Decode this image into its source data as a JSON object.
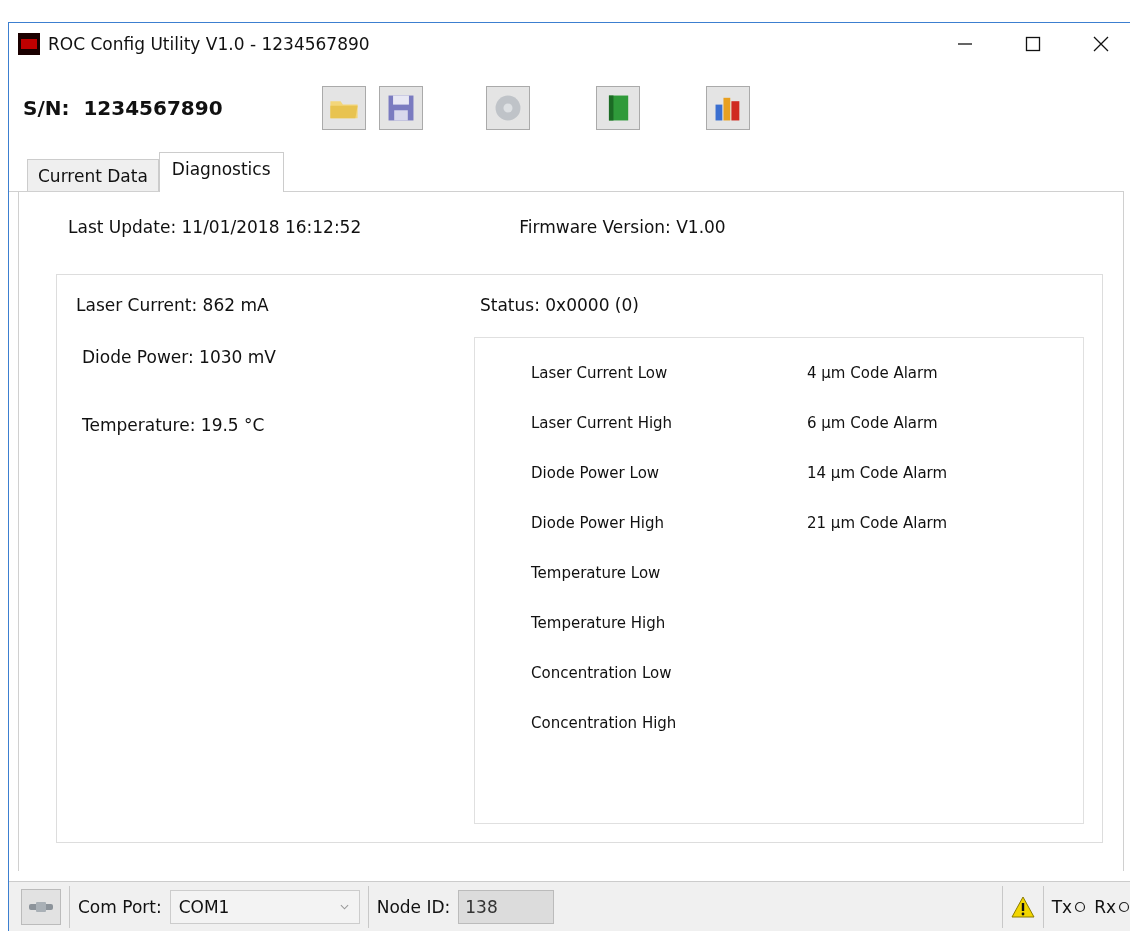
{
  "window": {
    "title": "ROC Config Utility V1.0 - 1234567890"
  },
  "serial": {
    "label": "S/N:",
    "value": "1234567890"
  },
  "toolbar": [
    {
      "kind": "open"
    },
    {
      "kind": "save"
    },
    {
      "kind": "disc"
    },
    {
      "kind": "book"
    },
    {
      "kind": "chart"
    }
  ],
  "tabs": [
    {
      "label": "Current Data",
      "selected": false
    },
    {
      "label": "Diagnostics",
      "selected": true
    }
  ],
  "last_update": {
    "label": "Last Update:",
    "value": "11/01/2018 16:12:52"
  },
  "firmware": {
    "label": "Firmware Version:",
    "value": "V1.00"
  },
  "readings": [
    {
      "label": "Laser Current:",
      "value": "862 mA"
    },
    {
      "label": "Diode Power:",
      "value": "1030 mV"
    },
    {
      "label": "Temperature:",
      "value": "19.5 °C"
    }
  ],
  "status": {
    "label": "Status:",
    "value": "0x0000 (0)"
  },
  "alarms_left": [
    "Laser Current Low",
    "Laser Current High",
    "Diode Power Low",
    "Diode Power High",
    "Temperature Low",
    "Temperature High",
    "Concentration Low",
    "Concentration High"
  ],
  "alarms_right": [
    "4 µm Code Alarm",
    "6 µm Code Alarm",
    "14 µm Code Alarm",
    "21 µm Code Alarm"
  ],
  "status_bar": {
    "com_port_label": "Com Port:",
    "com_port": "COM1",
    "node_id_label": "Node ID:",
    "node_id": "138",
    "tx": "Tx",
    "rx": "Rx"
  }
}
